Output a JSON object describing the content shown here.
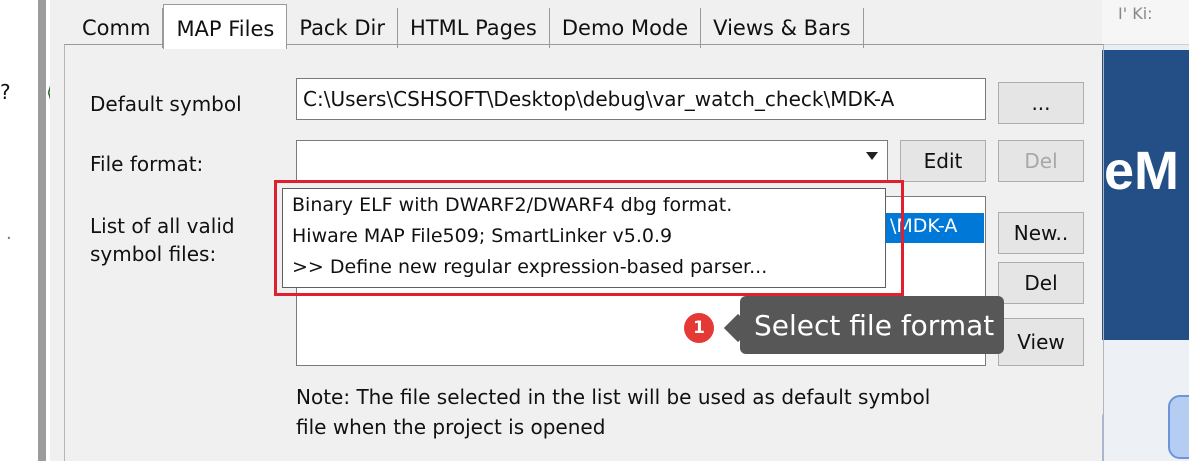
{
  "background": {
    "left_text": "?",
    "right_top_text": "I' Ki:",
    "right_big_text": "eM"
  },
  "tabs": [
    {
      "label": "Comm"
    },
    {
      "label": "MAP Files"
    },
    {
      "label": "Pack Dir"
    },
    {
      "label": "HTML Pages"
    },
    {
      "label": "Demo Mode"
    },
    {
      "label": "Views & Bars"
    }
  ],
  "active_tab": "MAP Files",
  "form": {
    "default_symbol_label": "Default symbol",
    "default_symbol_value": "C:\\Users\\CSHSOFT\\Desktop\\debug\\var_watch_check\\MDK-A",
    "browse_label": "...",
    "file_format_label": "File format:",
    "file_format_value": "",
    "edit_label": "Edit",
    "del_label": "Del",
    "list_label_line1": "List of all valid",
    "list_label_line2": "symbol files:",
    "list_selected_item": "\\MDK-A",
    "new_label": "New..",
    "del2_label": "Del",
    "view_label": "View",
    "note_line1": "Note: The file selected in the list will be used as default symbol",
    "note_line2": "file when the project is opened"
  },
  "dropdown_options": [
    "Binary ELF with DWARF2/DWARF4 dbg format.",
    "Hiware MAP File509; SmartLinker v5.0.9",
    ">> Define new regular expression-based parser..."
  ],
  "annotation": {
    "badge_number": "1",
    "tooltip_text": "Select file format",
    "highlight_color": "#e0202f"
  },
  "colors": {
    "selection": "#0078d7",
    "tooltip_bg": "#575757",
    "badge": "#e53935"
  }
}
